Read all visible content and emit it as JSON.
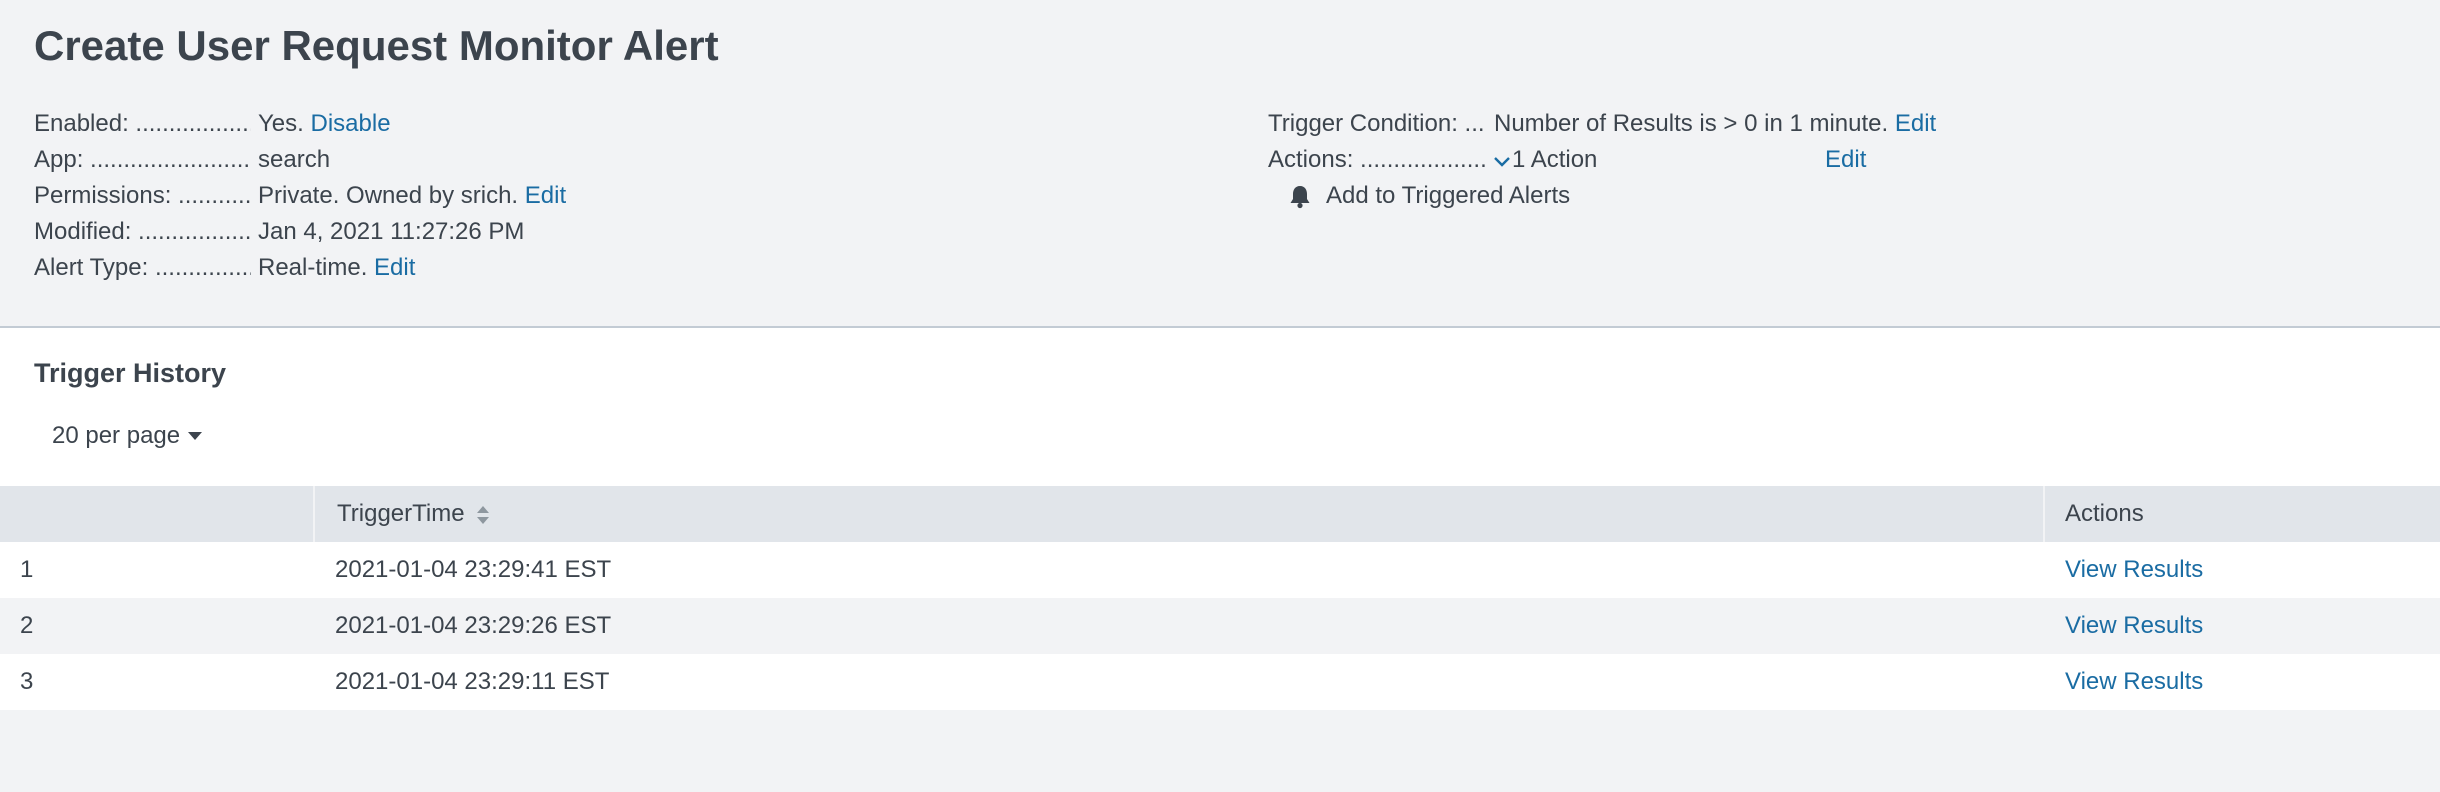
{
  "page": {
    "title": "Create User Request Monitor Alert"
  },
  "details_left": {
    "enabled": {
      "label": "Enabled: ....................................",
      "value": "Yes.",
      "link": "Disable"
    },
    "app": {
      "label": "App: ..................................................",
      "value": "search"
    },
    "permissions": {
      "label": "Permissions: ...........................",
      "value": "Private. Owned by srich.",
      "link": "Edit"
    },
    "modified": {
      "label": "Modified: ....................................",
      "value": "Jan 4, 2021 11:27:26 PM"
    },
    "alert_type": {
      "label": "Alert Type: .................................",
      "value": "Real-time.",
      "link": "Edit"
    }
  },
  "details_right": {
    "trigger_condition": {
      "label": "Trigger Condition: ..........",
      "value": "Number of Results is > 0 in 1 minute.",
      "link": "Edit"
    },
    "actions": {
      "label": "Actions: .........................................",
      "value": "1 Action",
      "link": "Edit",
      "item": "Add to Triggered Alerts"
    }
  },
  "trigger_history": {
    "title": "Trigger History",
    "per_page": "20 per page",
    "columns": [
      "",
      "TriggerTime",
      "Actions"
    ],
    "rows": [
      {
        "index": "1",
        "time": "2021-01-04 23:29:41 EST",
        "action": "View Results"
      },
      {
        "index": "2",
        "time": "2021-01-04 23:29:26 EST",
        "action": "View Results"
      },
      {
        "index": "3",
        "time": "2021-01-04 23:29:11 EST",
        "action": "View Results"
      }
    ]
  },
  "colors": {
    "link": "#1a6ca3",
    "text": "#3c444d",
    "background": "#f2f3f5",
    "header": "#e1e5ea"
  },
  "icons": {
    "chevron": "chevron-down-icon",
    "bell": "bell-icon",
    "sort": "sort-icon"
  }
}
